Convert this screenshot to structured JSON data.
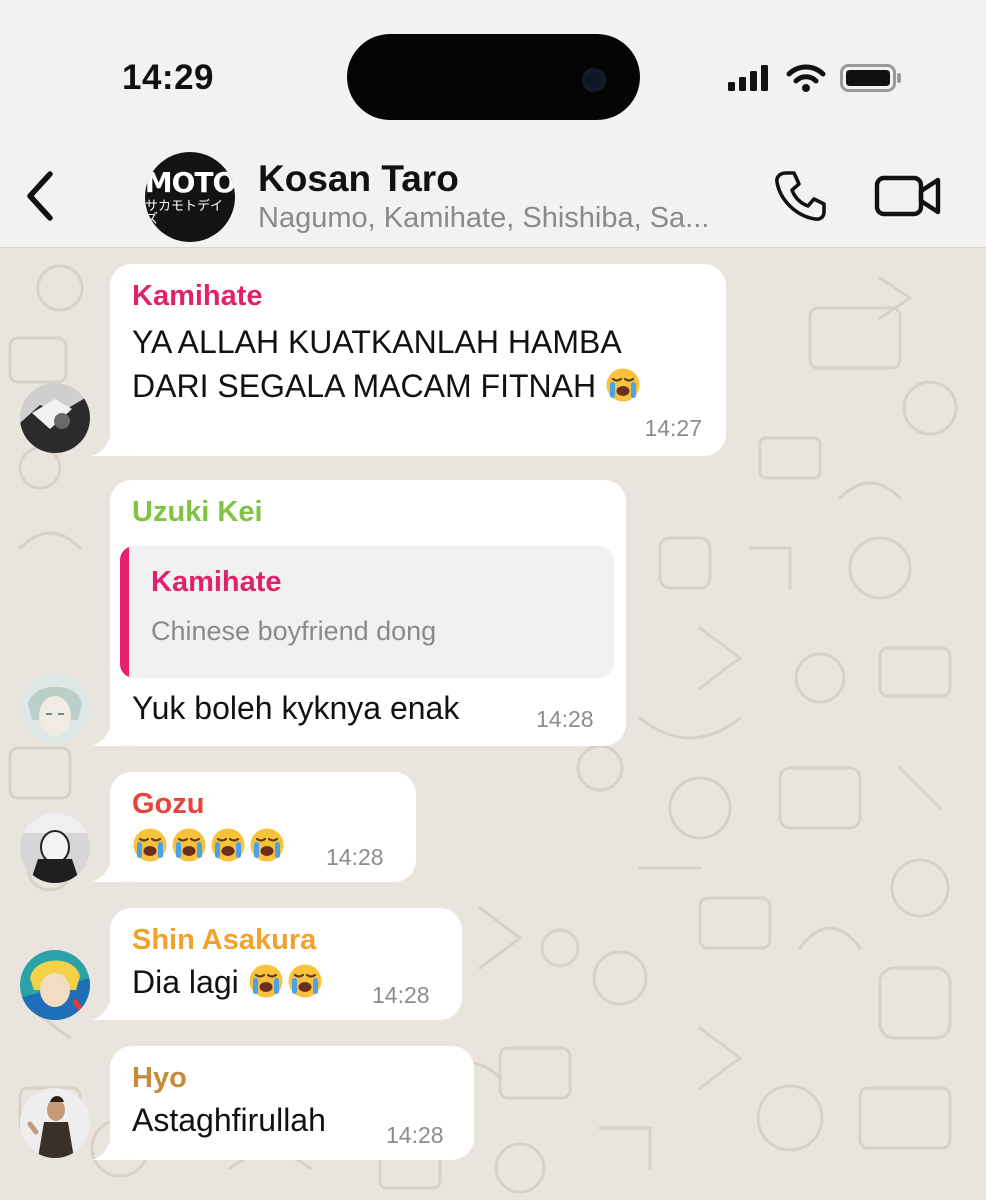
{
  "status_bar": {
    "time": "14:29"
  },
  "header": {
    "group_name": "Kosan Taro",
    "members": "Nagumo, Kamihate, Shishiba, Sa...",
    "avatar_logo_text": "MOTO",
    "avatar_logo_sub": "サカモトデイズ"
  },
  "messages": [
    {
      "sender": "Kamihate",
      "sender_color": "#e0226e",
      "text": "YA ALLAH KUATKANLAH HAMBA DARI SEGALA MACAM FITNAH",
      "time": "14:27"
    },
    {
      "sender": "Uzuki Kei",
      "sender_color": "#80c342",
      "reply_to": {
        "sender": "Kamihate",
        "text": "Chinese boyfriend dong"
      },
      "text": "Yuk boleh kyknya enak",
      "time": "14:28"
    },
    {
      "sender": "Gozu",
      "sender_color": "#e5453a",
      "emoji_count": 4,
      "time": "14:28"
    },
    {
      "sender": "Shin Asakura",
      "sender_color": "#f0a22b",
      "text": "Dia lagi",
      "emoji_count": 2,
      "time": "14:28"
    },
    {
      "sender": "Hyo",
      "sender_color": "#c78a3a",
      "text": "Astaghfirullah",
      "time": "14:28"
    }
  ],
  "icons": {
    "back": "chevron-left-icon",
    "call": "phone-icon",
    "video": "video-camera-icon",
    "emoji": "loudly-crying-face-emoji"
  }
}
